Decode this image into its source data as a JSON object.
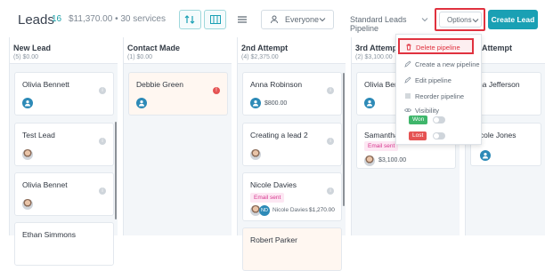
{
  "header": {
    "title": "Leads",
    "count": "16",
    "summary": "$11,370.00 • 30 services",
    "owner_filter": "Everyone",
    "pipeline_select": "Standard Leads Pipeline",
    "options_label": "Options",
    "create_label": "Create Lead"
  },
  "columns": [
    {
      "name": "New Lead",
      "sub": "(5) $0.00"
    },
    {
      "name": "Contact Made",
      "sub": "(1) $0.00"
    },
    {
      "name": "2nd Attempt",
      "sub": "(4) $2,375.00"
    },
    {
      "name": "3rd Attempt",
      "sub": "(2) $3,100.00"
    },
    {
      "name": "Attempt",
      "sub": ""
    }
  ],
  "cards": {
    "c1": {
      "name": "Olivia Bennett"
    },
    "c2": {
      "name": "Test Lead"
    },
    "c3": {
      "name": "Olivia Bennet"
    },
    "c4": {
      "name": "Ethan Simmons"
    },
    "c5": {
      "name": "Debbie Green"
    },
    "c6": {
      "name": "Anna Robinson",
      "value": "$800.00"
    },
    "c7": {
      "name": "Creating a lead 2"
    },
    "c8": {
      "name": "Nicole Davies",
      "tag": "Email sent",
      "owner": "Nicole Davies",
      "owner_initials": "ND",
      "value": "$1,270.00"
    },
    "c9": {
      "name": "Robert Parker"
    },
    "c10": {
      "name": "Olivia Bennett"
    },
    "c11": {
      "name": "Samantha Mi",
      "tag": "Email sent",
      "value": "$3,100.00"
    },
    "c12": {
      "name": "na Jefferson"
    },
    "c13": {
      "name": "icole Jones"
    }
  },
  "menu": {
    "delete": "Delete pipeline",
    "create": "Create a new pipeline",
    "edit": "Edit pipeline",
    "reorder": "Reorder pipeline",
    "visibility": "Visibility",
    "won": "Won",
    "lost": "Lost"
  },
  "colors": {
    "accent": "#1aa0b4",
    "won": "#3fb66b",
    "lost": "#e55353",
    "highlight": "#e0323f"
  }
}
